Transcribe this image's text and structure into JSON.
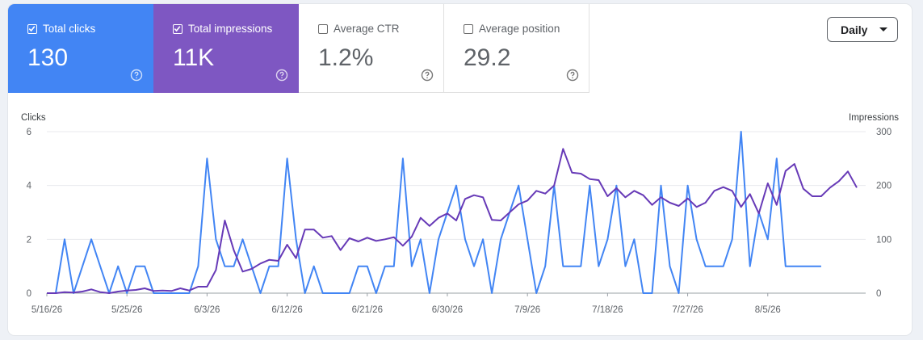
{
  "metrics": [
    {
      "label": "Total clicks",
      "value": "130",
      "active": true,
      "color": "#4285f4"
    },
    {
      "label": "Total impressions",
      "value": "11K",
      "active": true,
      "color": "#7e57c2"
    },
    {
      "label": "Average CTR",
      "value": "1.2%",
      "active": false,
      "color": "#ffffff"
    },
    {
      "label": "Average position",
      "value": "29.2",
      "active": false,
      "color": "#ffffff"
    }
  ],
  "granularity": {
    "selected": "Daily"
  },
  "chart_data": {
    "type": "line",
    "x_tick_labels": [
      "5/16/26",
      "5/25/26",
      "6/3/26",
      "6/12/26",
      "6/21/26",
      "6/30/26",
      "7/9/26",
      "7/18/26",
      "7/27/26",
      "8/5/26"
    ],
    "x_tick_dates": [
      "2026-05-16",
      "2026-05-25",
      "2026-06-03",
      "2026-06-12",
      "2026-06-21",
      "2026-06-30",
      "2026-07-09",
      "2026-07-18",
      "2026-07-27",
      "2026-08-05"
    ],
    "x_range": [
      "2026-05-16",
      "2026-08-16"
    ],
    "left_axis": {
      "label": "Clicks",
      "range": [
        0,
        6
      ],
      "ticks": [
        0,
        2,
        4,
        6
      ]
    },
    "right_axis": {
      "label": "Impressions",
      "range": [
        0,
        300
      ],
      "ticks": [
        0,
        100,
        200,
        300
      ]
    },
    "grid": true,
    "series": [
      {
        "name": "Total clicks",
        "axis": "left",
        "color": "#4285f4",
        "values": [
          0,
          0,
          2,
          0,
          1,
          2,
          1,
          0,
          1,
          0,
          1,
          1,
          0,
          0,
          0,
          0,
          0,
          1,
          5,
          2,
          1,
          1,
          2,
          1,
          0,
          1,
          1,
          5,
          2,
          0,
          1,
          0,
          0,
          0,
          0,
          1,
          1,
          0,
          1,
          1,
          5,
          1,
          2,
          0,
          2,
          3,
          4,
          2,
          1,
          2,
          0,
          2,
          3,
          4,
          2,
          0,
          1,
          4,
          1,
          1,
          1,
          4,
          1,
          2,
          4,
          1,
          2,
          0,
          0,
          4,
          1,
          0,
          4,
          2,
          1,
          1,
          1,
          2,
          6,
          1,
          3,
          2,
          5,
          1,
          1,
          1,
          1,
          1
        ]
      },
      {
        "name": "Total impressions",
        "axis": "right",
        "color": "#673ab7",
        "values": [
          0,
          0,
          2,
          1,
          3,
          7,
          2,
          0,
          3,
          5,
          6,
          9,
          4,
          5,
          4,
          9,
          5,
          12,
          12,
          43,
          135,
          80,
          40,
          45,
          55,
          62,
          60,
          90,
          65,
          118,
          118,
          103,
          106,
          80,
          102,
          96,
          103,
          97,
          100,
          104,
          88,
          105,
          140,
          125,
          140,
          148,
          135,
          175,
          182,
          178,
          136,
          135,
          150,
          165,
          172,
          190,
          185,
          200,
          268,
          224,
          222,
          212,
          210,
          180,
          195,
          178,
          190,
          182,
          164,
          178,
          168,
          162,
          176,
          160,
          168,
          190,
          197,
          190,
          160,
          184,
          148,
          204,
          164,
          227,
          240,
          194,
          180,
          180,
          196,
          208,
          226,
          196
        ]
      }
    ]
  }
}
